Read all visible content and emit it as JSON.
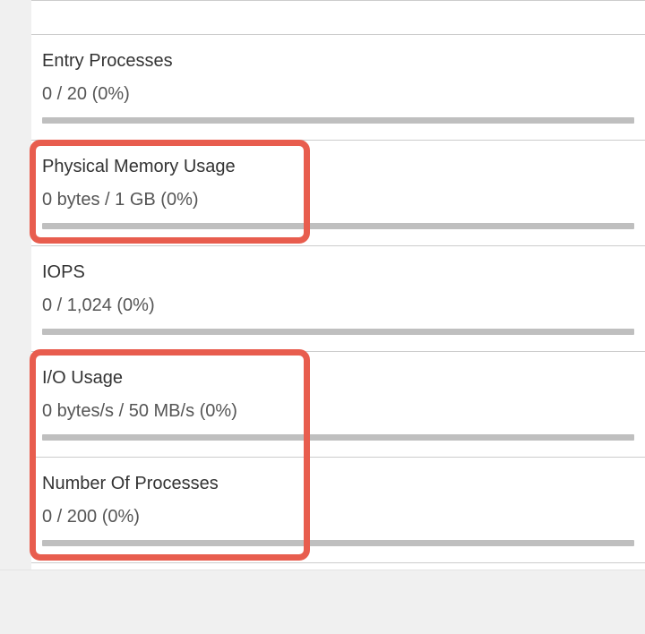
{
  "metrics": [
    {
      "title": "Entry Processes",
      "value": "0 / 20   (0%)"
    },
    {
      "title": "Physical Memory Usage",
      "value": "0 bytes / 1 GB   (0%)"
    },
    {
      "title": "IOPS",
      "value": "0 / 1,024   (0%)"
    },
    {
      "title": "I/O Usage",
      "value": "0 bytes/s / 50 MB/s   (0%)"
    },
    {
      "title": "Number Of Processes",
      "value": "0 / 200   (0%)"
    }
  ]
}
